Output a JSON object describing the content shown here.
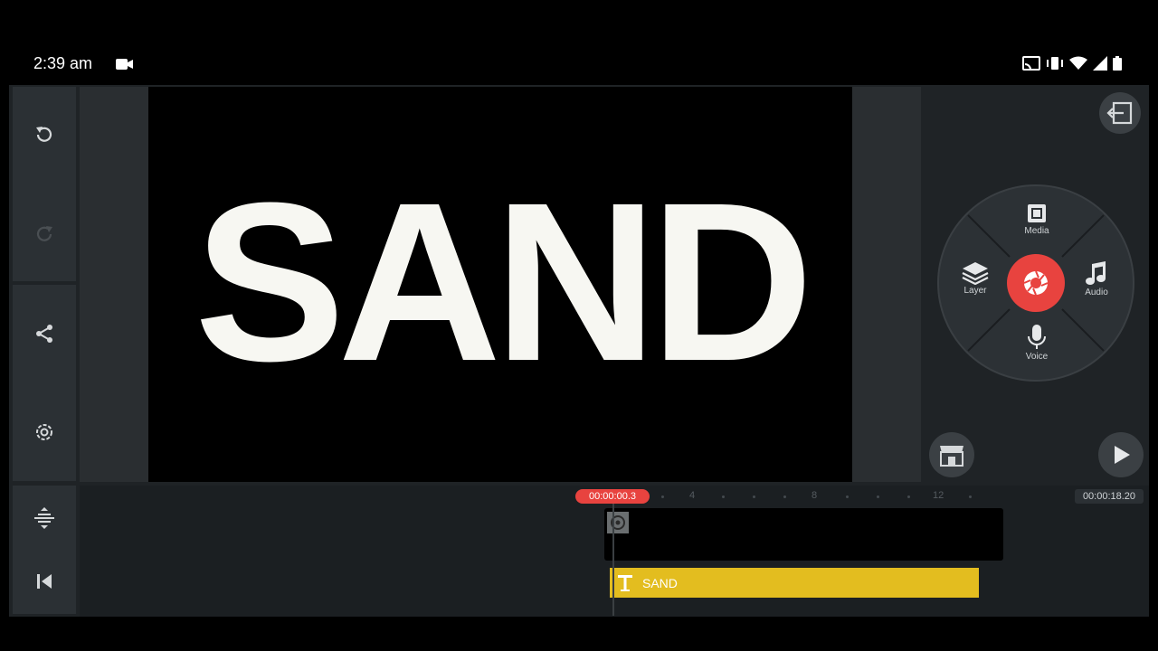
{
  "status_bar": {
    "time": "2:39 am",
    "icons": [
      "cast-icon",
      "vibrate-icon",
      "wifi-icon",
      "signal-icon",
      "battery-icon"
    ]
  },
  "left_toolbar": {
    "items": [
      "undo-icon",
      "redo-icon",
      "share-icon",
      "settings-icon",
      "timeline-expand-icon",
      "skip-to-start-icon"
    ]
  },
  "preview": {
    "text": "SAND"
  },
  "media_wheel": {
    "media_label": "Media",
    "layer_label": "Layer",
    "audio_label": "Audio",
    "voice_label": "Voice",
    "center": "camera-record-icon"
  },
  "buttons": {
    "exit": "exit-icon",
    "store": "store-icon",
    "play": "play-icon"
  },
  "timeline": {
    "playhead_time": "00:00:00.3",
    "duration": "00:00:18.20",
    "tick_labels": [
      "4",
      "8",
      "12"
    ],
    "text_clip_label": "SAND"
  },
  "colors": {
    "accent_red": "#e8433f",
    "text_clip_yellow": "#e3bd1f",
    "panel": "#2b3034"
  }
}
